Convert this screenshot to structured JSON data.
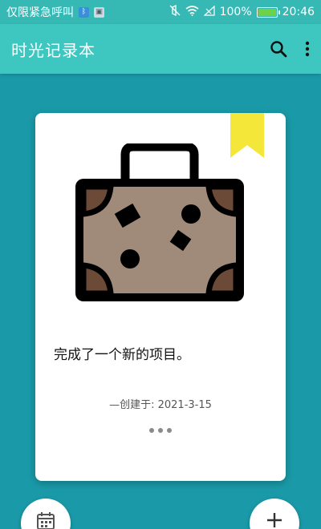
{
  "status_bar": {
    "carrier_text": "仅限紧急呼叫",
    "battery_percent": "100%",
    "time": "20:46",
    "icons": [
      "bluetooth-icon",
      "image-icon",
      "mute-icon",
      "wifi-icon",
      "signal-icon",
      "battery-icon"
    ]
  },
  "app_bar": {
    "title": "时光记录本",
    "icons": [
      "search-icon",
      "more-vert-icon"
    ]
  },
  "card": {
    "illustration": "suitcase-icon",
    "entry_text": "完成了一个新的项目。",
    "created_label": "—创建于: 2021-3-15",
    "bookmark_color": "#f5e63a"
  },
  "fabs": {
    "left_icon": "calendar-icon",
    "right_icon": "plus-icon"
  },
  "colors": {
    "background": "#1a9aa8",
    "app_bar": "#3ec6c0",
    "status_bar": "#36b8b4",
    "suitcase_body": "#a08a7a",
    "suitcase_corner": "#6b4a38"
  }
}
